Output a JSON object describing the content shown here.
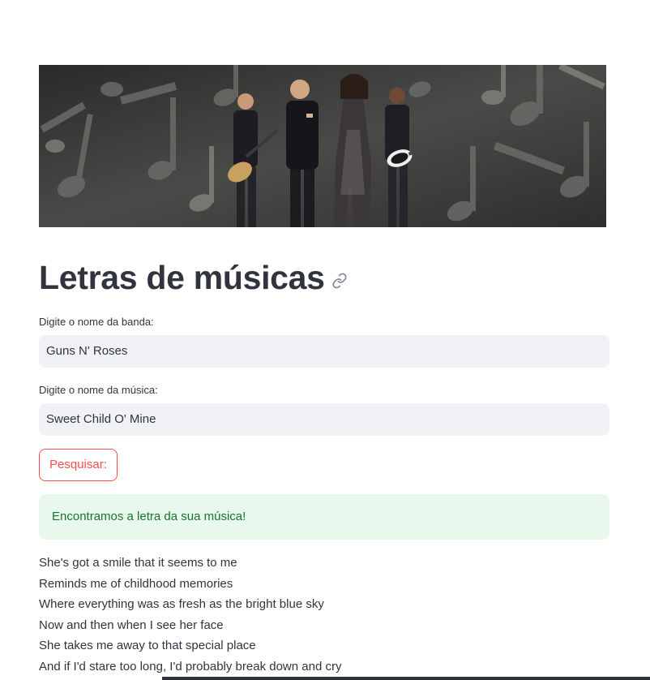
{
  "banner": {
    "image_description_icon": "band-performance-image"
  },
  "header": {
    "title": "Letras de músicas"
  },
  "form": {
    "band_label": "Digite o nome da banda:",
    "band_value": "Guns N' Roses",
    "song_label": "Digite o nome da música:",
    "song_value": "Sweet Child O' Mine",
    "search_button_label": "Pesquisar:"
  },
  "result": {
    "success_message": "Encontramos a letra da sua música!",
    "lyrics": [
      "She's got a smile that it seems to me",
      "Reminds me of childhood memories",
      "Where everything was as fresh as the bright blue sky",
      "Now and then when I see her face",
      "She takes me away to that special place",
      "And if I'd stare too long, I'd probably break down and cry"
    ]
  },
  "colors": {
    "accent": "#ff4b4b",
    "text": "#31333f",
    "input_bg": "#f0f2f6",
    "success_bg": "#e8f8ec",
    "success_text": "#177233"
  }
}
